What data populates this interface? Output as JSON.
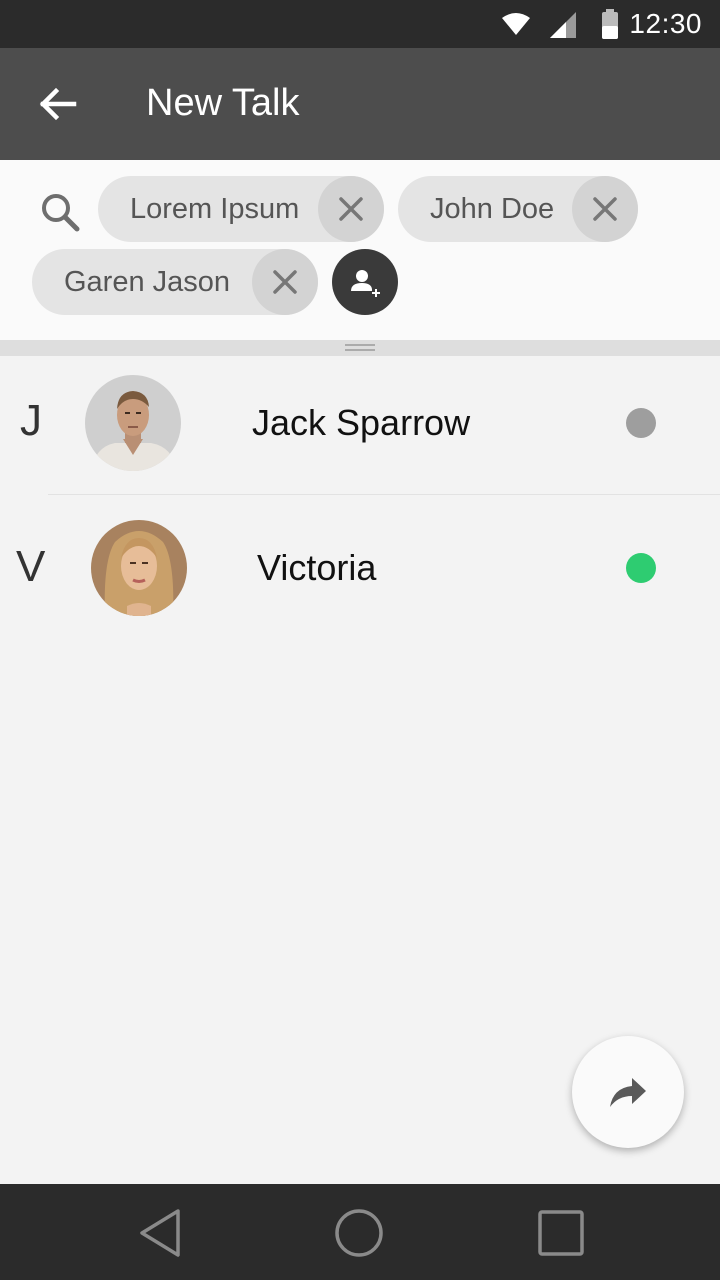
{
  "status_bar": {
    "time": "12:30",
    "icons": [
      "wifi-icon",
      "cell-signal-icon",
      "battery-icon"
    ]
  },
  "app_bar": {
    "title": "New Talk",
    "back_icon": "arrow-back-icon"
  },
  "recipients": {
    "search_icon": "search-icon",
    "chips": [
      {
        "label": "Lorem Ipsum",
        "remove_icon": "close-icon"
      },
      {
        "label": "John Doe",
        "remove_icon": "close-icon"
      },
      {
        "label": "Garen Jason",
        "remove_icon": "close-icon"
      }
    ],
    "add_icon": "add-person-icon"
  },
  "contacts": [
    {
      "letter": "J",
      "name": "Jack Sparrow",
      "status_color": "#9e9e9e"
    },
    {
      "letter": "V",
      "name": "Victoria",
      "status_color": "#2ecc71"
    }
  ],
  "fab": {
    "icon": "share-forward-icon"
  },
  "nav_bar": {
    "icons": [
      "nav-back-icon",
      "nav-home-icon",
      "nav-recents-icon"
    ]
  },
  "colors": {
    "status_bar": "#2b2b2b",
    "app_bar": "#4d4d4d",
    "online": "#2ecc71",
    "offline": "#9e9e9e"
  }
}
